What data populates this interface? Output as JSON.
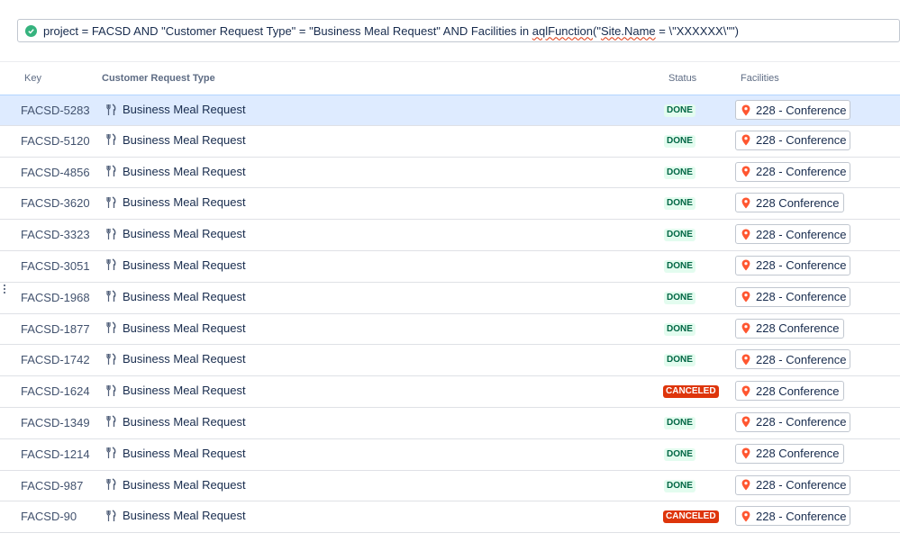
{
  "query": {
    "part1": "project = FACSD AND \"Customer Request Type\" = \"Business Meal Request\" AND Facilities in ",
    "fn": "aqlFunction",
    "part2": "(\"",
    "site": "Site.Name",
    "part3": " = \\\"XXXXXX\\\"\")"
  },
  "columns": {
    "key": "Key",
    "type": "Customer Request Type",
    "status": "Status",
    "facilities": "Facilities"
  },
  "rows": [
    {
      "key": "FACSD-5283",
      "type": "Business Meal Request",
      "status": "DONE",
      "facility": "228 - Conference"
    },
    {
      "key": "FACSD-5120",
      "type": "Business Meal Request",
      "status": "DONE",
      "facility": "228 - Conference"
    },
    {
      "key": "FACSD-4856",
      "type": "Business Meal Request",
      "status": "DONE",
      "facility": "228 - Conference"
    },
    {
      "key": "FACSD-3620",
      "type": "Business Meal Request",
      "status": "DONE",
      "facility": "228 Conference"
    },
    {
      "key": "FACSD-3323",
      "type": "Business Meal Request",
      "status": "DONE",
      "facility": "228 - Conference"
    },
    {
      "key": "FACSD-3051",
      "type": "Business Meal Request",
      "status": "DONE",
      "facility": "228 - Conference"
    },
    {
      "key": "FACSD-1968",
      "type": "Business Meal Request",
      "status": "DONE",
      "facility": "228 - Conference"
    },
    {
      "key": "FACSD-1877",
      "type": "Business Meal Request",
      "status": "DONE",
      "facility": "228 Conference"
    },
    {
      "key": "FACSD-1742",
      "type": "Business Meal Request",
      "status": "DONE",
      "facility": "228 - Conference"
    },
    {
      "key": "FACSD-1624",
      "type": "Business Meal Request",
      "status": "CANCELED",
      "facility": "228 Conference"
    },
    {
      "key": "FACSD-1349",
      "type": "Business Meal Request",
      "status": "DONE",
      "facility": "228 - Conference"
    },
    {
      "key": "FACSD-1214",
      "type": "Business Meal Request",
      "status": "DONE",
      "facility": "228 Conference"
    },
    {
      "key": "FACSD-987",
      "type": "Business Meal Request",
      "status": "DONE",
      "facility": "228 - Conference"
    },
    {
      "key": "FACSD-90",
      "type": "Business Meal Request",
      "status": "CANCELED",
      "facility": "228 - Conference"
    }
  ],
  "colors": {
    "valid_query": "#36b37e",
    "done_bg": "#e3fcef",
    "done_text": "#006644",
    "canceled_bg": "#de350b",
    "pin": "#ff5630",
    "selected_row": "#deebff"
  },
  "icons": {
    "query_status": "check-circle-icon",
    "request_type": "cutlery-icon",
    "facility": "location-pin-icon"
  }
}
